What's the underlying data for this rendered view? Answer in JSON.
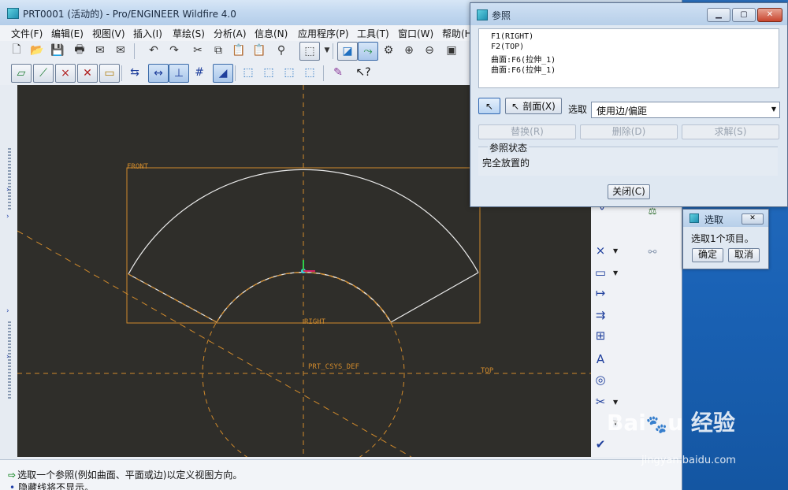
{
  "window": {
    "title": "PRT0001 (活动的) - Pro/ENGINEER Wildfire 4.0"
  },
  "menu": [
    {
      "label": "文件(F)"
    },
    {
      "label": "编辑(E)"
    },
    {
      "label": "视图(V)"
    },
    {
      "label": "插入(I)"
    },
    {
      "label": "草绘(S)"
    },
    {
      "label": "分析(A)"
    },
    {
      "label": "信息(N)"
    },
    {
      "label": "应用程序(P)"
    },
    {
      "label": "工具(T)"
    },
    {
      "label": "窗口(W)"
    },
    {
      "label": "帮助(H"
    }
  ],
  "canvas": {
    "labels": {
      "front": "FRONT",
      "right": "RIGHT",
      "top": "TOP",
      "csys": "PRT_CSYS_DEF"
    },
    "colors": {
      "background": "#2f2e2a",
      "datum": "#d08a2c",
      "sketch": "#e8e8e8"
    }
  },
  "messages": {
    "line1": "选取一个参照(例如曲面、平面或边)以定义视图方向。",
    "line2": "隐藏线将不显示。"
  },
  "ref_dialog": {
    "title": "参照",
    "items": [
      "F1(RIGHT)",
      "F2(TOP)",
      "曲面:F6(拉伸_1)",
      "曲面:F6(拉伸_1)"
    ],
    "section_button": "剖面(X)",
    "select_label": "选取",
    "dropdown_value": "使用边/偏距",
    "replace_button": "替换(R)",
    "delete_button": "删除(D)",
    "solve_button": "求解(S)",
    "status_caption": "参照状态",
    "status_value": "完全放置的",
    "close_button": "关闭(C)"
  },
  "select_dialog": {
    "title": "选取",
    "message": "选取1个项目。",
    "ok_button": "确定",
    "cancel_button": "取消"
  },
  "watermark": {
    "logo": "Bai经验",
    "url": "jingyan.baidu.com"
  }
}
